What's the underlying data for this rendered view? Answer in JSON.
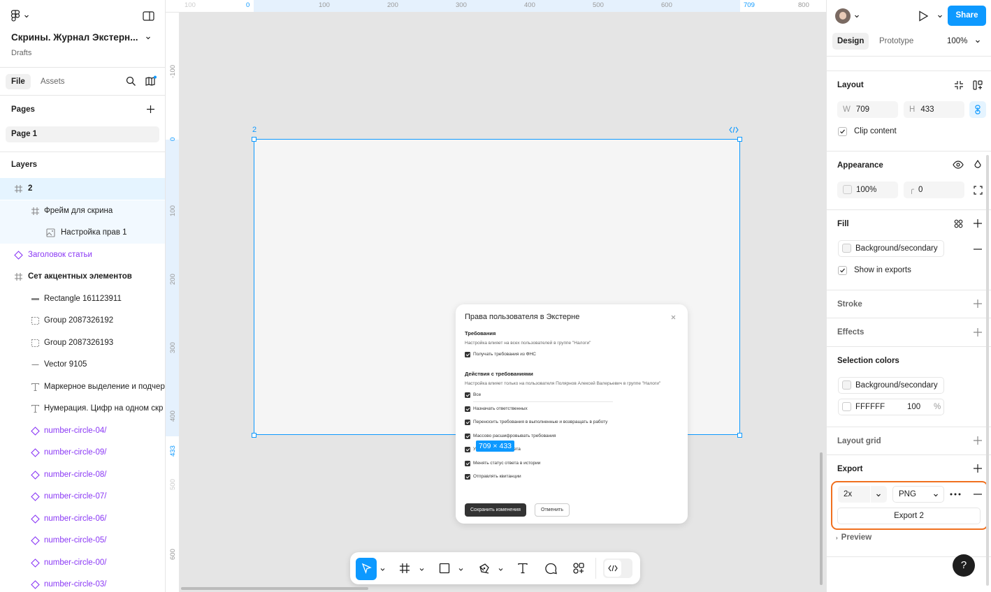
{
  "app": {
    "file_title": "Скрины. Журнал Экстерн...",
    "file_location": "Drafts"
  },
  "left_tabs": {
    "file": "File",
    "assets": "Assets"
  },
  "pages": {
    "title": "Pages",
    "items": [
      "Page 1"
    ]
  },
  "layers": {
    "title": "Layers",
    "items": [
      {
        "label": "2",
        "icon": "frame-icon",
        "indent": 0
      },
      {
        "label": "Фрейм для скрина",
        "icon": "frame-icon",
        "indent": 1
      },
      {
        "label": "Настройка прав 1",
        "icon": "image-icon",
        "indent": 2
      },
      {
        "label": "Заголовок статьи",
        "icon": "component-icon",
        "indent": 0
      },
      {
        "label": "Сет акцентных элементов",
        "icon": "frame-icon",
        "indent": 0
      },
      {
        "label": "Rectangle 161123911",
        "icon": "rectangle-icon",
        "indent": 1
      },
      {
        "label": "Group 2087326192",
        "icon": "group-icon",
        "indent": 1
      },
      {
        "label": "Group 2087326193",
        "icon": "group-icon",
        "indent": 1
      },
      {
        "label": "Vector 9105",
        "icon": "line-icon",
        "indent": 1
      },
      {
        "label": "Маркерное выделение и подчер",
        "icon": "text-icon",
        "indent": 1
      },
      {
        "label": "Нумерация. Цифр на одном скр",
        "icon": "text-icon",
        "indent": 1
      },
      {
        "label": "number-circle-04/",
        "icon": "component-icon",
        "indent": 1
      },
      {
        "label": "number-circle-09/",
        "icon": "component-icon",
        "indent": 1
      },
      {
        "label": "number-circle-08/",
        "icon": "component-icon",
        "indent": 1
      },
      {
        "label": "number-circle-07/",
        "icon": "component-icon",
        "indent": 1
      },
      {
        "label": "number-circle-06/",
        "icon": "component-icon",
        "indent": 1
      },
      {
        "label": "number-circle-05/",
        "icon": "component-icon",
        "indent": 1
      },
      {
        "label": "number-circle-00/",
        "icon": "component-icon",
        "indent": 1
      },
      {
        "label": "number-circle-03/",
        "icon": "component-icon",
        "indent": 1
      }
    ]
  },
  "ruler_top": [
    "100",
    "0",
    "100",
    "200",
    "300",
    "400",
    "500",
    "600",
    "709",
    "800"
  ],
  "ruler_left": [
    "-100",
    "0",
    "100",
    "200",
    "300",
    "400",
    "433",
    "500",
    "600"
  ],
  "frame": {
    "name": "2",
    "size_badge": "709 × 433"
  },
  "dialog": {
    "title": "Права пользователя в Экстерне",
    "section1_title": "Требования",
    "section1_desc": "Настройка влияет на всех пользователей в группе \"Налоги\"",
    "section1_items": [
      "Получать требования из ФНС"
    ],
    "section2_title": "Действия с требованиями",
    "section2_desc": "Настройка влияет только на пользователя Полярнов Алексей Валерьевич в группе \"Налоги\"",
    "section2_items": [
      "Все",
      "Назначать ответственных",
      "Переносить требования в выполненные и возвращать в работу",
      "Массово расшифровывать требования",
      "Указывать срок ответа",
      "Менять статус ответа в истории",
      "Отправлять квитанции"
    ],
    "save_label": "Сохранить изменения",
    "cancel_label": "Отменить"
  },
  "right": {
    "tabs": {
      "design": "Design",
      "prototype": "Prototype"
    },
    "zoom": "100%",
    "share_label": "Share",
    "layout": {
      "title": "Layout",
      "w_label": "W",
      "w": "709",
      "h_label": "H",
      "h": "433",
      "clip_label": "Clip content"
    },
    "appearance": {
      "title": "Appearance",
      "opacity": "100%",
      "radius": "0"
    },
    "fill": {
      "title": "Fill",
      "style_name": "Background/secondary",
      "show_in_exports": "Show in exports"
    },
    "stroke": {
      "title": "Stroke"
    },
    "effects": {
      "title": "Effects"
    },
    "selection_colors": {
      "title": "Selection colors",
      "style_name": "Background/secondary",
      "hex": "FFFFFF",
      "opacity": "100",
      "pct": "%"
    },
    "layout_grid": {
      "title": "Layout grid"
    },
    "export": {
      "title": "Export",
      "scale": "2x",
      "format": "PNG",
      "button": "Export 2",
      "preview": "Preview"
    }
  },
  "colors": {
    "accent": "#0d99ff",
    "highlight": "#f0701f",
    "component": "#8a38f5"
  }
}
